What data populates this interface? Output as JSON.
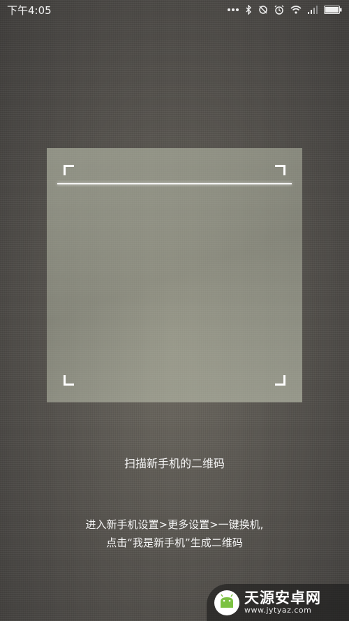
{
  "status_bar": {
    "time": "下午4:05",
    "icons": [
      "more-dots-icon",
      "bluetooth-icon",
      "do-not-disturb-icon",
      "alarm-icon",
      "wifi-icon",
      "signal-icon",
      "battery-icon"
    ]
  },
  "scanner": {
    "title": "扫描新手机的二维码",
    "instructions": [
      "进入新手机设置>更多设置>一键换机,",
      "点击“我是新手机”生成二维码"
    ]
  },
  "watermark": {
    "name": "天源安卓网",
    "url": "www.jytyaz.com"
  }
}
